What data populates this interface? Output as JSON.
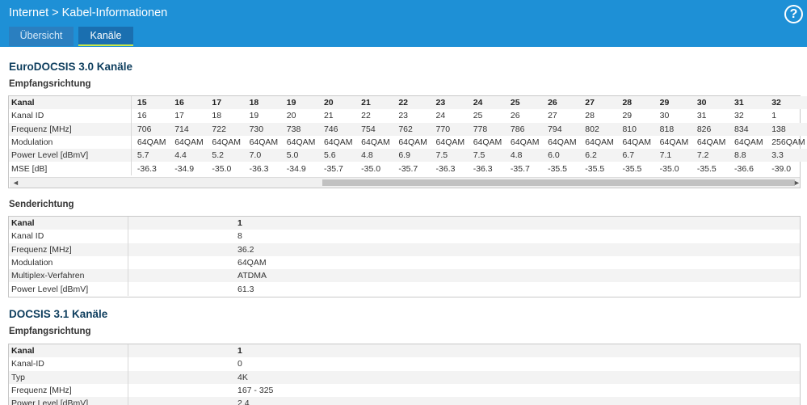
{
  "breadcrumb": {
    "part1": "Internet",
    "separator": ">",
    "part2": "Kabel-Informationen"
  },
  "help_label": "?",
  "tabs": [
    {
      "label": "Übersicht"
    },
    {
      "label": "Kanäle"
    }
  ],
  "section_eurodocsis": {
    "title": "EuroDOCSIS 3.0 Kanäle"
  },
  "downstream": {
    "title": "Empfangsrichtung",
    "rows": [
      {
        "label": "Kanal",
        "values": [
          "15",
          "16",
          "17",
          "18",
          "19",
          "20",
          "21",
          "22",
          "23",
          "24",
          "25",
          "26",
          "27",
          "28",
          "29",
          "30",
          "31",
          "32"
        ]
      },
      {
        "label": "Kanal ID",
        "values": [
          "16",
          "17",
          "18",
          "19",
          "20",
          "21",
          "22",
          "23",
          "24",
          "25",
          "26",
          "27",
          "28",
          "29",
          "30",
          "31",
          "32",
          "1"
        ]
      },
      {
        "label": "Frequenz [MHz]",
        "values": [
          "706",
          "714",
          "722",
          "730",
          "738",
          "746",
          "754",
          "762",
          "770",
          "778",
          "786",
          "794",
          "802",
          "810",
          "818",
          "826",
          "834",
          "138"
        ]
      },
      {
        "label": "Modulation",
        "values": [
          "64QAM",
          "64QAM",
          "64QAM",
          "64QAM",
          "64QAM",
          "64QAM",
          "64QAM",
          "64QAM",
          "64QAM",
          "64QAM",
          "64QAM",
          "64QAM",
          "64QAM",
          "64QAM",
          "64QAM",
          "64QAM",
          "64QAM",
          "256QAM"
        ]
      },
      {
        "label": "Power Level [dBmV]",
        "values": [
          "5.7",
          "4.4",
          "5.2",
          "7.0",
          "5.0",
          "5.6",
          "4.8",
          "6.9",
          "7.5",
          "7.5",
          "4.8",
          "6.0",
          "6.2",
          "6.7",
          "7.1",
          "7.2",
          "8.8",
          "3.3"
        ]
      },
      {
        "label": "MSE [dB]",
        "values": [
          "-36.3",
          "-34.9",
          "-35.0",
          "-36.3",
          "-34.9",
          "-35.7",
          "-35.0",
          "-35.7",
          "-36.3",
          "-36.3",
          "-35.7",
          "-35.5",
          "-35.5",
          "-35.5",
          "-35.0",
          "-35.5",
          "-36.6",
          "-39.0"
        ]
      }
    ]
  },
  "upstream": {
    "title": "Senderichtung",
    "rows": [
      {
        "label": "Kanal",
        "value": "1"
      },
      {
        "label": "Kanal ID",
        "value": "8"
      },
      {
        "label": "Frequenz [MHz]",
        "value": "36.2"
      },
      {
        "label": "Modulation",
        "value": "64QAM"
      },
      {
        "label": "Multiplex-Verfahren",
        "value": "ATDMA"
      },
      {
        "label": "Power Level [dBmV]",
        "value": "61.3"
      }
    ]
  },
  "section_docsis31": {
    "title": "DOCSIS 3.1 Kanäle"
  },
  "docsis31_downstream": {
    "title": "Empfangsrichtung",
    "rows": [
      {
        "label": "Kanal",
        "value": "1"
      },
      {
        "label": "Kanal-ID",
        "value": "0"
      },
      {
        "label": "Typ",
        "value": "4K"
      },
      {
        "label": "Frequenz [MHz]",
        "value": "167 - 325"
      },
      {
        "label": "Power Level [dBmV]",
        "value": "2.4"
      }
    ]
  }
}
